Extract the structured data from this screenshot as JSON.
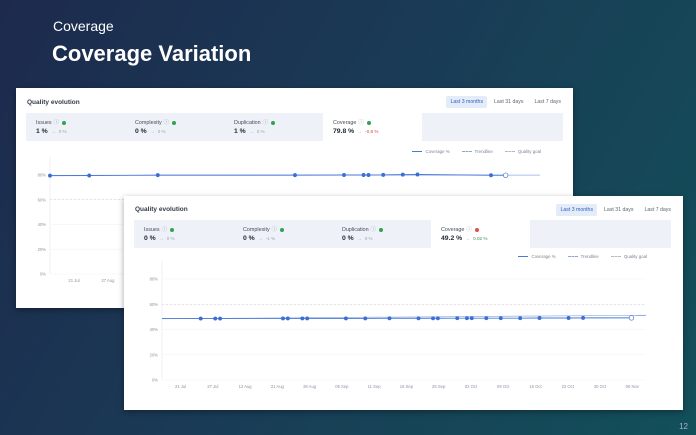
{
  "slide": {
    "subtitle": "Coverage",
    "title": "Coverage Variation",
    "page_number": "12"
  },
  "colors": {
    "accent": "#4a7ad8",
    "good": "#2ea44f",
    "bad": "#e0504c"
  },
  "cards": [
    {
      "title": "Quality evolution",
      "periods": [
        {
          "label": "Last 3 months",
          "active": true
        },
        {
          "label": "Last 31 days",
          "active": false
        },
        {
          "label": "Last 7 days",
          "active": false
        }
      ],
      "metrics": [
        {
          "label": "Issues",
          "value": "1 %",
          "arrow": "→",
          "delta": "0 %",
          "status": "good",
          "delta_tone": "neutral",
          "selected": false
        },
        {
          "label": "Complexity",
          "value": "0 %",
          "arrow": "→",
          "delta": "0 %",
          "status": "good",
          "delta_tone": "neutral",
          "selected": false
        },
        {
          "label": "Duplication",
          "value": "1 %",
          "arrow": "→",
          "delta": "0 %",
          "status": "good",
          "delta_tone": "neutral",
          "selected": false
        },
        {
          "label": "Coverage",
          "value": "79.8 %",
          "arrow": "→",
          "delta": "-0.8 %",
          "status": "good",
          "delta_tone": "neg",
          "selected": true
        }
      ],
      "legend": [
        "Coverage %",
        "Trendline",
        "Quality goal"
      ],
      "chart_data": {
        "type": "line",
        "y_ticks": [
          "80%",
          "60%",
          "40%",
          "20%",
          "0%"
        ],
        "x_ticks": [
          "21 Jul",
          "27 Aug"
        ],
        "ylim": [
          0,
          80
        ],
        "goal": 60,
        "series": [
          {
            "name": "Coverage %",
            "x": [
              0.0,
              0.08,
              0.22,
              0.5,
              0.6,
              0.64,
              0.65,
              0.68,
              0.72,
              0.75,
              0.9,
              0.93
            ],
            "values": [
              79.5,
              79.6,
              79.9,
              79.9,
              80.0,
              80.0,
              80.0,
              80.1,
              80.3,
              80.4,
              79.8,
              79.8
            ]
          },
          {
            "name": "Trendline",
            "x": [
              0,
              1
            ],
            "values": [
              79.7,
              79.9
            ]
          }
        ]
      }
    },
    {
      "title": "Quality evolution",
      "periods": [
        {
          "label": "Last 3 months",
          "active": true
        },
        {
          "label": "Last 31 days",
          "active": false
        },
        {
          "label": "Last 7 days",
          "active": false
        }
      ],
      "metrics": [
        {
          "label": "Issues",
          "value": "0 %",
          "arrow": "→",
          "delta": "0 %",
          "status": "good",
          "delta_tone": "neutral",
          "selected": false
        },
        {
          "label": "Complexity",
          "value": "0 %",
          "arrow": "→",
          "delta": "-1 %",
          "status": "good",
          "delta_tone": "neutral",
          "selected": false
        },
        {
          "label": "Duplication",
          "value": "0 %",
          "arrow": "→",
          "delta": "0 %",
          "status": "good",
          "delta_tone": "neutral",
          "selected": false
        },
        {
          "label": "Coverage",
          "value": "49.2 %",
          "arrow": "→",
          "delta": "0.02 %",
          "status": "bad",
          "delta_tone": "pos",
          "selected": true
        }
      ],
      "legend": [
        "Coverage %",
        "Trendline",
        "Quality goal"
      ],
      "chart_data": {
        "type": "line",
        "y_ticks": [
          "80%",
          "60%",
          "40%",
          "20%",
          "0%"
        ],
        "x_ticks": [
          "21 Jul",
          "27 Jul",
          "12 Aug",
          "21 Aug",
          "28 Aug",
          "05 Sep",
          "11 Sep",
          "18 Sep",
          "25 Sep",
          "02 Oct",
          "09 Oct",
          "16 Oct",
          "23 Oct",
          "30 Oct",
          "06 Nov"
        ],
        "ylim": [
          0,
          80
        ],
        "goal": 60,
        "series": [
          {
            "name": "Coverage %",
            "x": [
              0.08,
              0.11,
              0.12,
              0.25,
              0.26,
              0.29,
              0.3,
              0.38,
              0.42,
              0.47,
              0.53,
              0.56,
              0.57,
              0.61,
              0.63,
              0.64,
              0.67,
              0.7,
              0.74,
              0.78,
              0.84,
              0.87,
              0.97
            ],
            "values": [
              48.7,
              48.7,
              48.7,
              48.8,
              48.8,
              48.8,
              48.8,
              48.8,
              48.8,
              48.9,
              48.9,
              48.9,
              48.9,
              49.0,
              49.0,
              49.0,
              49.0,
              49.0,
              49.0,
              49.1,
              49.1,
              49.2,
              49.2
            ]
          },
          {
            "name": "Trendline",
            "x": [
              0,
              1
            ],
            "values": [
              48.5,
              51.3
            ]
          }
        ]
      }
    }
  ]
}
